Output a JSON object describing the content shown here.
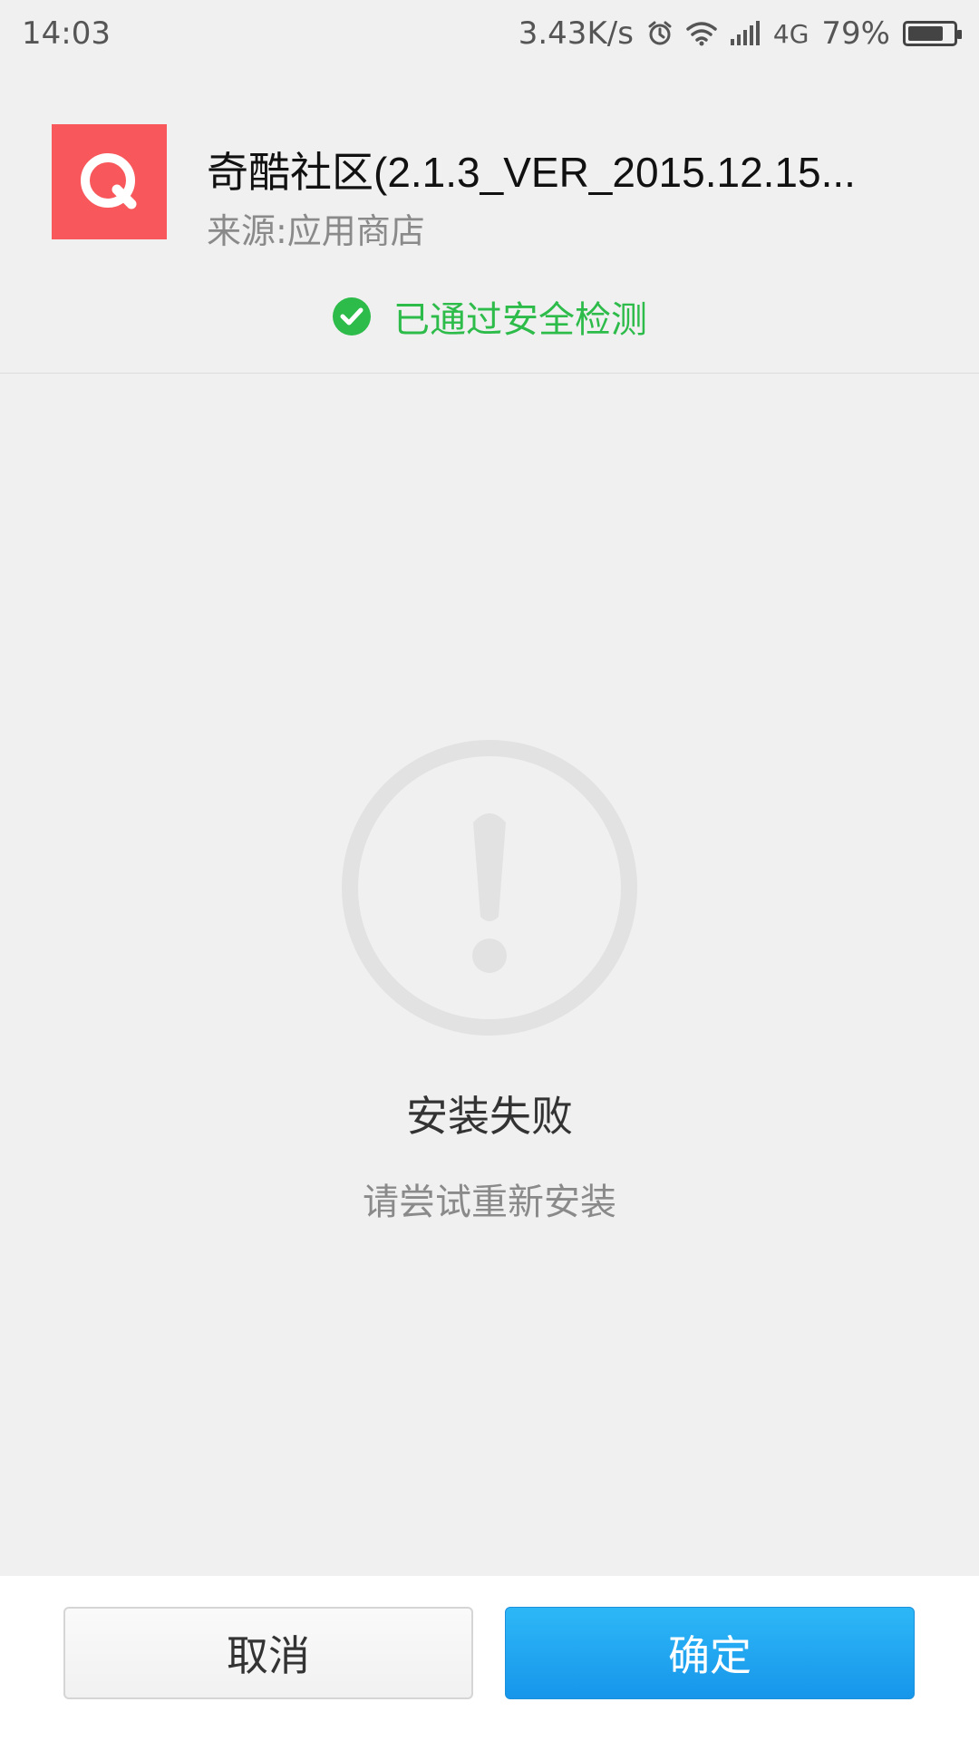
{
  "status_bar": {
    "time": "14:03",
    "net_speed": "3.43K/s",
    "network": "4G",
    "battery": "79%",
    "battery_level": 0.79,
    "icons": [
      "alarm-icon",
      "wifi-icon",
      "signal-icon",
      "battery-icon"
    ]
  },
  "app": {
    "icon_letter": "Q",
    "icon_color": "#f8585b",
    "title": "奇酷社区(2.1.3_VER_2015.12.15...",
    "source": "来源:应用商店"
  },
  "security": {
    "text": "已通过安全检测",
    "color": "#2dbb4a",
    "icon": "check-circle-icon"
  },
  "result": {
    "icon": "exclamation-circle-icon",
    "title": "安装失败",
    "subtitle": "请尝试重新安装"
  },
  "buttons": {
    "cancel_label": "取消",
    "ok_label": "确定",
    "ok_color": "#1e9ff0"
  }
}
